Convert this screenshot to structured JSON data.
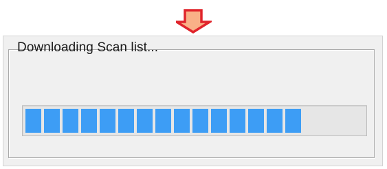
{
  "dialog": {
    "status_text": "Downloading Scan list...",
    "progress_percent": 85
  },
  "icons": {
    "pointer": "down-arrow-icon"
  },
  "colors": {
    "arrow_fill": "#f9b187",
    "arrow_stroke": "#e0242b",
    "progress_chunk": "#3d9df5",
    "dialog_background": "#f0f0f0"
  }
}
